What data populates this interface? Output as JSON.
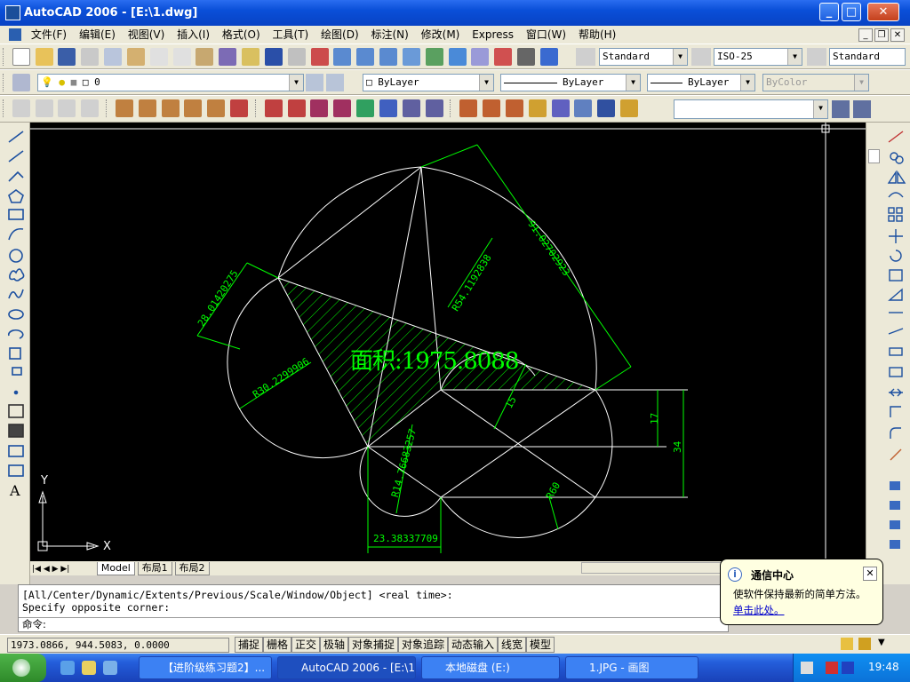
{
  "window": {
    "title": "AutoCAD 2006 - [E:\\1.dwg]"
  },
  "menu": [
    "文件(F)",
    "编辑(E)",
    "视图(V)",
    "插入(I)",
    "格式(O)",
    "工具(T)",
    "绘图(D)",
    "标注(N)",
    "修改(M)",
    "Express",
    "窗口(W)",
    "帮助(H)"
  ],
  "toolbar": {
    "text_style": "Standard",
    "dim_style": "ISO-25",
    "table_style": "Standard",
    "layer": "0",
    "color": "ByLayer",
    "linetype": "ByLayer",
    "lineweight": "ByLayer",
    "plotstyle": "ByColor"
  },
  "drawing": {
    "area_label": "面积:1975.8088",
    "dims": [
      "28.01420275",
      "R30.2299906",
      "R54.1192838",
      "91.02702923",
      "15",
      "17",
      "34",
      "R14.76683257",
      "R60",
      "23.38337709"
    ],
    "ucs_x": "X",
    "ucs_y": "Y"
  },
  "layout_tabs": [
    "Model",
    "布局1",
    "布局2"
  ],
  "command": {
    "line1": "[All/Center/Dynamic/Extents/Previous/Scale/Window/Object] <real time>:",
    "line2": "Specify opposite corner:",
    "prompt": "命令:"
  },
  "balloon": {
    "title": "通信中心",
    "body": "使软件保持最新的简单方法。",
    "link": "单击此处。"
  },
  "status": {
    "coords": "1973.0866, 944.5083, 0.0000",
    "buttons": [
      "捕捉",
      "栅格",
      "正交",
      "极轴",
      "对象捕捉",
      "对象追踪",
      "动态输入",
      "线宽",
      "模型"
    ]
  },
  "taskbar": {
    "tasks": [
      "【进阶级练习题2】...",
      "AutoCAD 2006 - [E:\\1...",
      "本地磁盘 (E:)",
      "1.JPG - 画图"
    ],
    "clock": "19:48"
  },
  "colors": {
    "canvas": "#000000",
    "geometry": "#ffffff",
    "dimension": "#00ff00",
    "hatch": "#00ff00"
  }
}
